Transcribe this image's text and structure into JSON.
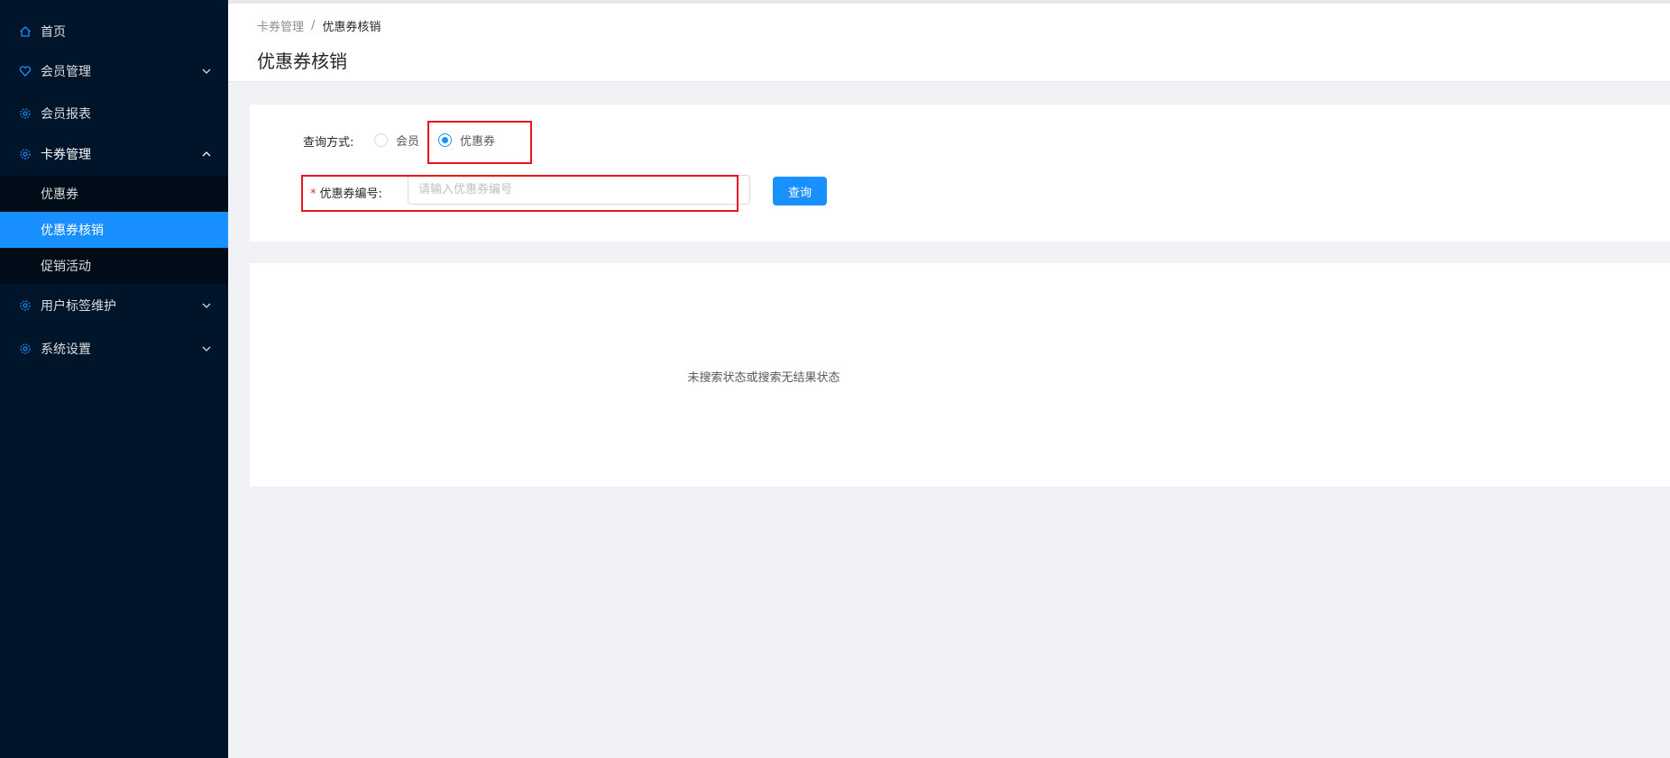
{
  "sidebar": {
    "items": [
      {
        "label": "首页",
        "icon": "home-icon"
      },
      {
        "label": "会员管理",
        "icon": "heart-icon"
      },
      {
        "label": "会员报表",
        "icon": "gear-icon"
      },
      {
        "label": "卡券管理",
        "icon": "gear-icon"
      },
      {
        "label": "用户标签维护",
        "icon": "gear-icon"
      },
      {
        "label": "系统设置",
        "icon": "gear-icon"
      }
    ],
    "subitems": [
      {
        "label": "优惠券"
      },
      {
        "label": "优惠券核销"
      },
      {
        "label": "促销活动"
      }
    ],
    "active_color": "#1890ff",
    "background": "#001529"
  },
  "header": {
    "breadcrumb": {
      "parent": "卡券管理",
      "separator": "/",
      "current": "优惠券核销"
    },
    "title": "优惠券核销"
  },
  "form": {
    "query_label": "查询方式:",
    "radio_member": "会员",
    "radio_coupon": "优惠券",
    "selected": "优惠券",
    "required_mark": "*",
    "coupon_label": "优惠券编号:",
    "coupon_value": "",
    "coupon_placeholder": "请输入优惠券编号",
    "query_button": "查询"
  },
  "result": {
    "empty_text": "未搜索状态或搜索无结果状态"
  },
  "highlight_color": "#e8141e"
}
